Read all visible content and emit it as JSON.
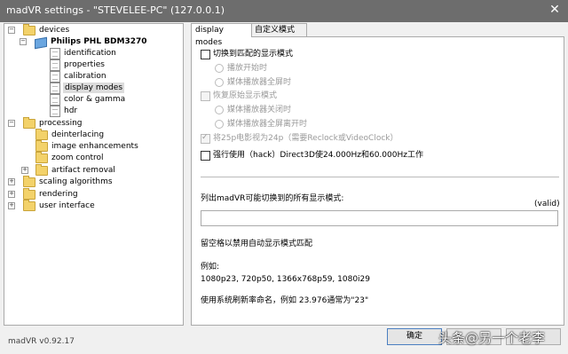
{
  "window": {
    "title": "madVR settings - \"STEVELEE-PC\" (127.0.0.1)",
    "close_glyph": "✕"
  },
  "tree": {
    "devices": "devices",
    "monitor": "Philips PHL BDM3270",
    "identification": "identification",
    "properties": "properties",
    "calibration": "calibration",
    "display_modes": "display modes",
    "color_gamma": "color & gamma",
    "hdr": "hdr",
    "processing": "processing",
    "deinterlacing": "deinterlacing",
    "image_enhancements": "image enhancements",
    "zoom_control": "zoom control",
    "artifact_removal": "artifact removal",
    "scaling_algorithms": "scaling algorithms",
    "rendering": "rendering",
    "user_interface": "user interface"
  },
  "tabs": {
    "display_modes": "display modes",
    "custom_modes": "自定义模式"
  },
  "options": {
    "switch_matching": "切换到匹配的显示模式",
    "playback_start": "播放开始时",
    "fullscreen": "媒体播放器全屏时",
    "restore_original": "恢复原始显示模式",
    "player_close": "媒体播放器关闭时",
    "leave_fullscreen": "媒体播放器全屏离开时",
    "treat_25p": "将25p电影视为24p（需要Reclock或VideoClock）",
    "force_hack": "强行使用（hack）Direct3D使24.000Hz和60.000Hz工作"
  },
  "modes": {
    "list_label": "列出madVR可能切换到的所有显示模式:",
    "valid": "(valid)",
    "value": "",
    "hint_blank": "留空格以禁用自动显示模式匹配",
    "example_title": "例如:",
    "example_values": "1080p23, 720p50, 1366x768p59, 1080i29",
    "rename_hint": "使用系统刷新率命名，例如 23.976通常为\"23\""
  },
  "footer": {
    "version": "madVR v0.92.17",
    "ok": "确定"
  },
  "watermark": "头条@另一个老李"
}
